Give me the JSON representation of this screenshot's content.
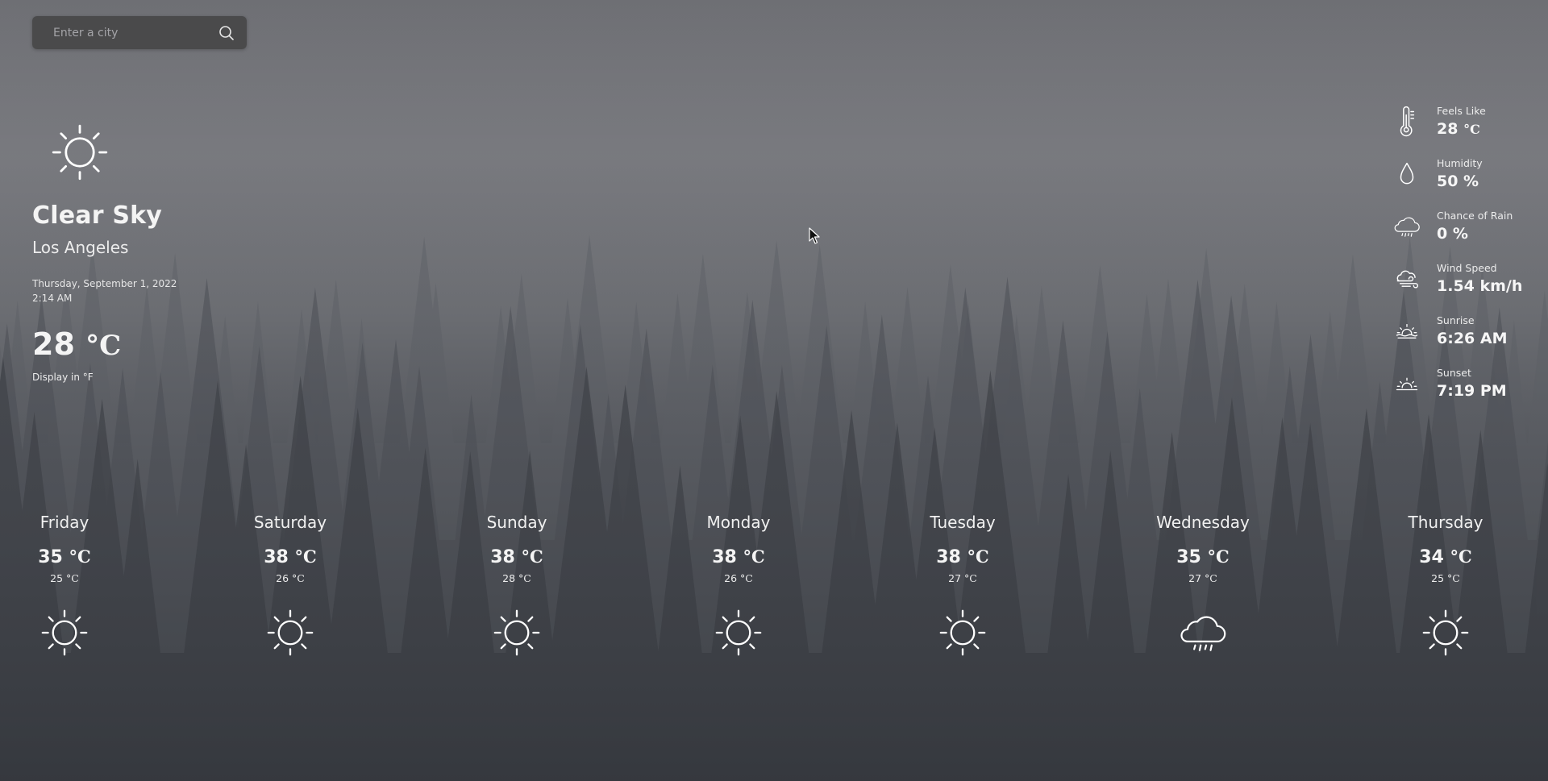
{
  "search": {
    "placeholder": "Enter a city"
  },
  "current": {
    "icon": "sun-icon",
    "condition": "Clear Sky",
    "city": "Los Angeles",
    "date": "Thursday, September 1, 2022",
    "time": "2:14 AM",
    "temp": "28",
    "unit": "°C",
    "display_toggle": "Display in °F"
  },
  "details": [
    {
      "icon": "thermometer-icon",
      "label": "Feels Like",
      "value": "28",
      "unit": "°C"
    },
    {
      "icon": "humidity-drop-icon",
      "label": "Humidity",
      "value": "50 %",
      "unit": ""
    },
    {
      "icon": "rain-cloud-icon",
      "label": "Chance of Rain",
      "value": "0 %",
      "unit": ""
    },
    {
      "icon": "wind-icon",
      "label": "Wind Speed",
      "value": "1.54 km/h",
      "unit": ""
    },
    {
      "icon": "sunrise-icon",
      "label": "Sunrise",
      "value": "6:26 AM",
      "unit": ""
    },
    {
      "icon": "sunset-icon",
      "label": "Sunset",
      "value": "7:19 PM",
      "unit": ""
    }
  ],
  "forecast": [
    {
      "day": "Friday",
      "max": "35",
      "min": "25",
      "unit": "°C",
      "icon": "sun-icon"
    },
    {
      "day": "Saturday",
      "max": "38",
      "min": "26",
      "unit": "°C",
      "icon": "sun-icon"
    },
    {
      "day": "Sunday",
      "max": "38",
      "min": "28",
      "unit": "°C",
      "icon": "sun-icon"
    },
    {
      "day": "Monday",
      "max": "38",
      "min": "26",
      "unit": "°C",
      "icon": "sun-icon"
    },
    {
      "day": "Tuesday",
      "max": "38",
      "min": "27",
      "unit": "°C",
      "icon": "sun-icon"
    },
    {
      "day": "Wednesday",
      "max": "35",
      "min": "27",
      "unit": "°C",
      "icon": "rain-cloud-icon"
    },
    {
      "day": "Thursday",
      "max": "34",
      "min": "25",
      "unit": "°C",
      "icon": "sun-icon"
    }
  ]
}
